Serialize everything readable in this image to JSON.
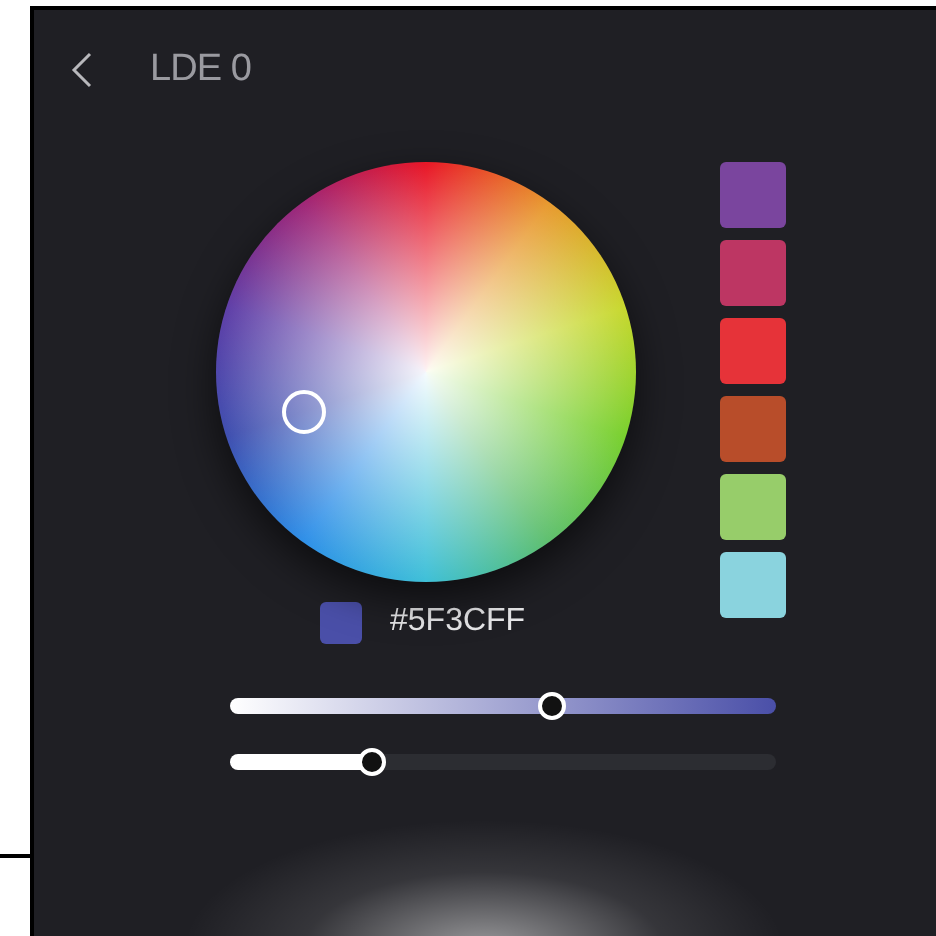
{
  "header": {
    "title": "LDE 0"
  },
  "presets": [
    {
      "color": "#7a459e"
    },
    {
      "color": "#bd3663"
    },
    {
      "color": "#e63339"
    },
    {
      "color": "#b84d2a"
    },
    {
      "color": "#97cd6a"
    },
    {
      "color": "#8ad3de"
    }
  ],
  "current": {
    "color": "#4a4fa8",
    "hex": "#5F3CFF"
  },
  "sliders": [
    {
      "kind": "saturation",
      "level": 0.59
    },
    {
      "kind": "brightness",
      "level": 0.26
    }
  ]
}
